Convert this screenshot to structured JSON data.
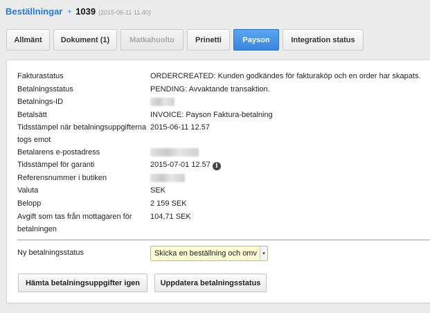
{
  "breadcrumb": {
    "parent": "Beställningar",
    "separator": "+",
    "order_id": "1039",
    "timestamp": "(2015-06-11 11.40)"
  },
  "tabs": [
    {
      "label": "Allmänt",
      "state": "normal"
    },
    {
      "label": "Dokument (1)",
      "state": "normal"
    },
    {
      "label": "Matkahuolto",
      "state": "disabled"
    },
    {
      "label": "Prinetti",
      "state": "normal"
    },
    {
      "label": "Payson",
      "state": "active"
    },
    {
      "label": "Integration status",
      "state": "normal"
    }
  ],
  "fields": [
    {
      "label": "Fakturastatus",
      "value": "ORDERCREATED: Kunden godkändes för fakturaköp och en order har skapats."
    },
    {
      "label": "Betalningsstatus",
      "value": "PENDING: Avvaktande transaktion."
    },
    {
      "label": "Betalnings-ID",
      "value": ""
    },
    {
      "label": "Betalsätt",
      "value": "INVOICE: Payson Faktura-betalning"
    },
    {
      "label": "Tidsstämpel när betalningsuppgifterna togs emot",
      "value": "2015-06-11 12.57"
    },
    {
      "label": "Betalarens e-postadress",
      "value": ""
    },
    {
      "label": "Tidsstämpel för garanti",
      "value": "2015-07-01 12.57"
    },
    {
      "label": "Referensnummer i butiken",
      "value": ""
    },
    {
      "label": "Valuta",
      "value": "SEK"
    },
    {
      "label": "Belopp",
      "value": "2 159 SEK"
    },
    {
      "label": "Avgift som tas från mottagaren för betalningen",
      "value": "104,71 SEK"
    }
  ],
  "new_status": {
    "label": "Ny betalningsstatus",
    "selected": "Skicka en beställning och omv"
  },
  "buttons": {
    "refetch": "Hämta betalningsuppgifter igen",
    "update": "Uppdatera betalningsstatus"
  },
  "info_icon_glyph": "i",
  "select_arrow_glyph": "▾",
  "colors": {
    "accent": "#2a78c8",
    "active_tab": "#4a97e6",
    "select_bg": "#fdfcd4"
  }
}
